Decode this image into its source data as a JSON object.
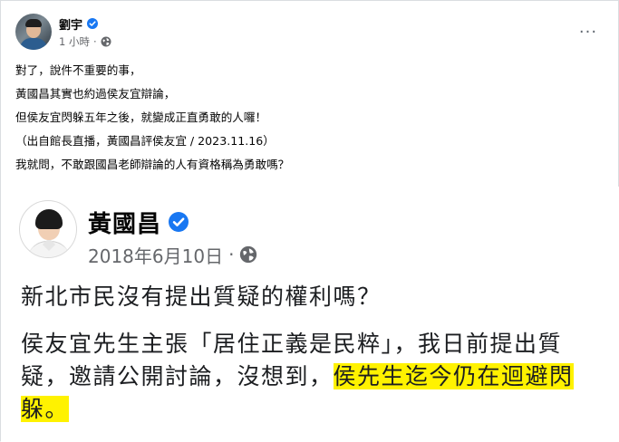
{
  "post": {
    "author_name": "劉宇",
    "timestamp": "1 小時",
    "meta_separator": "·",
    "more_label": "···",
    "lines": [
      "對了，說件不重要的事，",
      "黃國昌其實也約過侯友宜辯論，",
      "但侯友宜閃躲五年之後，就變成正直勇敢的人囉！",
      "（出自館長直播，黃國昌評侯友宜 / 2023.11.16）",
      "我就問，不敢跟國昌老師辯論的人有資格稱為勇敢嗎？"
    ]
  },
  "shared_post": {
    "author_name": "黃國昌",
    "date": "2018年6月10日",
    "meta_separator": "·",
    "question": "新北市民沒有提出質疑的權利嗎？",
    "para_line1": "侯友宜先生主張「居住正義是民粹」，我日前提出質",
    "para_line2_plain": "疑，邀請公開討論，沒想到，",
    "para_line2_highlight": "侯先生迄今仍在迴避閃",
    "para_line3_highlight": "躲。"
  },
  "icons": {
    "verified": "verified-badge-icon",
    "privacy": "globe-icon",
    "more": "more-options-icon"
  },
  "colors": {
    "verified_blue": "#1877f2",
    "meta_gray": "#65676b",
    "highlight": "#fff200"
  }
}
